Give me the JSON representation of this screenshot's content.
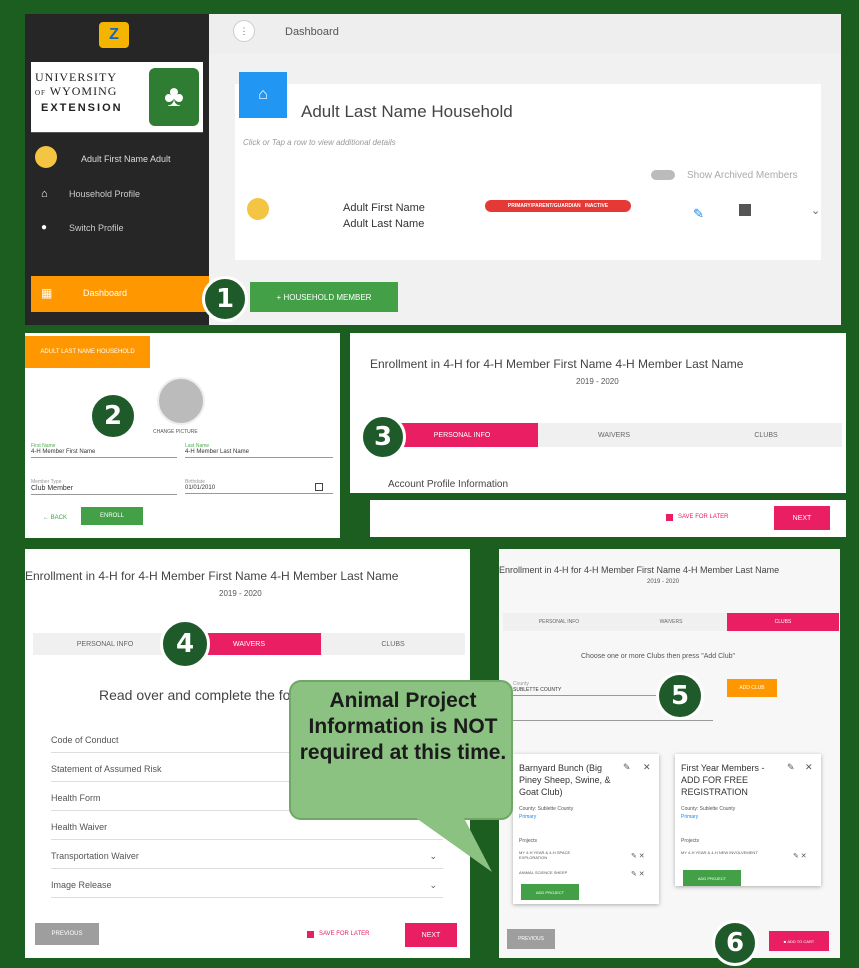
{
  "sidebar": {
    "logo_line1": "UNIVERSITY",
    "logo_line2": "WYOMING",
    "logo_of": "OF",
    "logo_line3": "EXTENSION",
    "user_name": "Adult First Name Adult",
    "items": [
      {
        "label": "Household Profile",
        "icon": "home-icon"
      },
      {
        "label": "Switch Profile",
        "icon": "person-icon"
      }
    ],
    "dashboard_label": "Dashboard"
  },
  "topbar": {
    "title": "Dashboard"
  },
  "household": {
    "title": "Adult Last Name Household",
    "hint": "Click or Tap a row to view additional details",
    "show_archived": "Show Archived Members",
    "member_first": "Adult First Name",
    "member_last": "Adult Last Name",
    "member_badge_status": "PRIMARY/PARENT/GUARDIAN   INACTIVE",
    "add_member_button": "+ HOUSEHOLD MEMBER"
  },
  "step2": {
    "header_button": "ADULT LAST NAME HOUSEHOLD",
    "photo_label": "CHANGE PICTURE",
    "first_name_label": "First Name",
    "first_name_value": "4-H Member First Name",
    "last_name_label": "Last Name",
    "last_name_value": "4-H Member Last Name",
    "member_type_label": "Member Type",
    "member_type_value": "Club Member",
    "birthdate_label": "Birthdate",
    "birthdate_value": "01/01/2010",
    "back_button": "← BACK",
    "enroll_button": "ENROLL"
  },
  "enroll": {
    "title": "Enrollment in 4-H for 4-H Member First Name 4-H Member Last Name",
    "year": "2019 - 2020",
    "tabs": [
      "PERSONAL INFO",
      "WAIVERS",
      "CLUBS"
    ],
    "section_title": "Account Profile Information",
    "save_later": "SAVE FOR LATER",
    "next": "NEXT",
    "previous": "PREVIOUS"
  },
  "step4": {
    "read_over": "Read over and complete the fo",
    "waivers": [
      "Code of Conduct",
      "Statement of Assumed Risk",
      "Health Form",
      "Health Waiver",
      "Transportation Waiver",
      "Image Release"
    ]
  },
  "step5": {
    "choose_text": "Choose one or more Clubs then press \"Add Club\"",
    "county_label": "County",
    "county_value": "SUBLETTE COUNTY",
    "add_club_button": "ADD CLUB",
    "club1": {
      "name": "Barnyard Bunch (Big Piney Sheep, Swine, & Goat Club)",
      "county": "County: Sublette County",
      "role": "Primary",
      "projects_label": "Projects",
      "projects": [
        "MY 4-H YEAR & 4-H SPACE EXPLORATION",
        "ANIMAL SCIENCE SHEEP"
      ],
      "add_project": "ADD PROJECT"
    },
    "club2": {
      "name": "First Year Members - ADD FOR FREE REGISTRATION",
      "county": "County: Sublette County",
      "role": "Primary",
      "projects_label": "Projects",
      "projects": [
        "MY 4-H YEAR & 4-H NEW INVOLVEMENT"
      ],
      "add_project": "ADD PROJECT"
    },
    "add_to_cart": "ADD TO CART"
  },
  "callout": {
    "text": "Animal Project Information is NOT required at this time."
  },
  "badges": [
    "1",
    "2",
    "3",
    "4",
    "5",
    "6"
  ],
  "colors": {
    "frame_green": "#1b5e20",
    "pink": "#e91e63",
    "green": "#43a047",
    "orange": "#ff9800",
    "callout": "#8bc181"
  }
}
